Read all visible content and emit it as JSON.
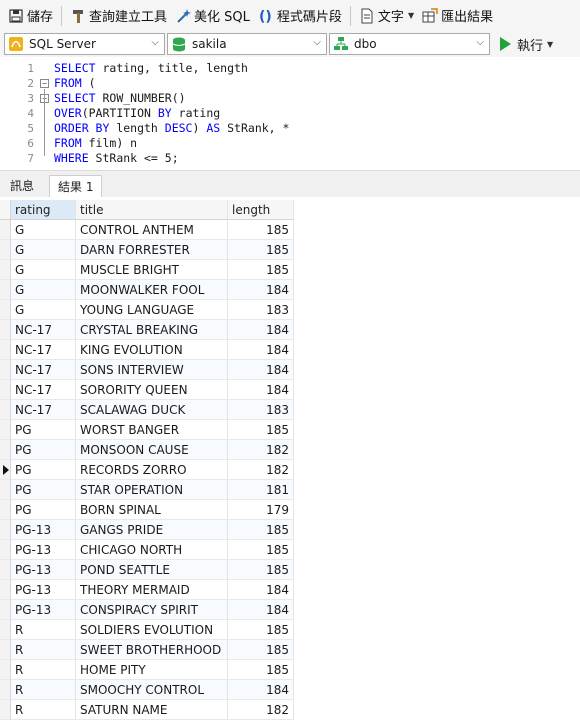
{
  "toolbar": {
    "save": "儲存",
    "query_builder": "查詢建立工具",
    "beautify": "美化 SQL",
    "snippet": "程式碼片段",
    "text": "文字",
    "export": "匯出結果"
  },
  "connection": {
    "server": "SQL Server",
    "database": "sakila",
    "schema": "dbo",
    "run": "執行"
  },
  "editor": {
    "lines": [
      {
        "num": "1",
        "parts": [
          {
            "t": "SELECT",
            "k": true
          },
          {
            "t": " rating, title, length",
            "k": false
          }
        ]
      },
      {
        "num": "2",
        "parts": [
          {
            "t": "FROM",
            "k": true
          },
          {
            "t": " (",
            "k": false
          }
        ]
      },
      {
        "num": "3",
        "parts": [
          {
            "t": "SELECT",
            "k": true
          },
          {
            "t": " ROW_NUMBER()",
            "k": false
          }
        ]
      },
      {
        "num": "4",
        "parts": [
          {
            "t": "OVER",
            "k": true
          },
          {
            "t": "(PARTITION ",
            "k": false
          },
          {
            "t": "BY",
            "k": true
          },
          {
            "t": " rating",
            "k": false
          }
        ]
      },
      {
        "num": "5",
        "parts": [
          {
            "t": "ORDER BY",
            "k": true
          },
          {
            "t": " length ",
            "k": false
          },
          {
            "t": "DESC",
            "k": true
          },
          {
            "t": ") ",
            "k": false
          },
          {
            "t": "AS",
            "k": true
          },
          {
            "t": " StRank, *",
            "k": false
          }
        ]
      },
      {
        "num": "6",
        "parts": [
          {
            "t": "FROM",
            "k": true
          },
          {
            "t": " film) n",
            "k": false
          }
        ]
      },
      {
        "num": "7",
        "parts": [
          {
            "t": "WHERE",
            "k": true
          },
          {
            "t": " StRank <= ",
            "k": false
          },
          {
            "t": "5",
            "k": false
          },
          {
            "t": ";",
            "k": false
          }
        ]
      }
    ]
  },
  "tabs": {
    "messages": "訊息",
    "result1": "結果 1"
  },
  "grid": {
    "columns": [
      "rating",
      "title",
      "length"
    ],
    "rows": [
      [
        "G",
        "CONTROL ANTHEM",
        "185"
      ],
      [
        "G",
        "DARN FORRESTER",
        "185"
      ],
      [
        "G",
        "MUSCLE BRIGHT",
        "185"
      ],
      [
        "G",
        "MOONWALKER FOOL",
        "184"
      ],
      [
        "G",
        "YOUNG LANGUAGE",
        "183"
      ],
      [
        "NC-17",
        "CRYSTAL BREAKING",
        "184"
      ],
      [
        "NC-17",
        "KING EVOLUTION",
        "184"
      ],
      [
        "NC-17",
        "SONS INTERVIEW",
        "184"
      ],
      [
        "NC-17",
        "SORORITY QUEEN",
        "184"
      ],
      [
        "NC-17",
        "SCALAWAG DUCK",
        "183"
      ],
      [
        "PG",
        "WORST BANGER",
        "185"
      ],
      [
        "PG",
        "MONSOON CAUSE",
        "182"
      ],
      [
        "PG",
        "RECORDS ZORRO",
        "182"
      ],
      [
        "PG",
        "STAR OPERATION",
        "181"
      ],
      [
        "PG",
        "BORN SPINAL",
        "179"
      ],
      [
        "PG-13",
        "GANGS PRIDE",
        "185"
      ],
      [
        "PG-13",
        "CHICAGO NORTH",
        "185"
      ],
      [
        "PG-13",
        "POND SEATTLE",
        "185"
      ],
      [
        "PG-13",
        "THEORY MERMAID",
        "184"
      ],
      [
        "PG-13",
        "CONSPIRACY SPIRIT",
        "184"
      ],
      [
        "R",
        "SOLDIERS EVOLUTION",
        "185"
      ],
      [
        "R",
        "SWEET BROTHERHOOD",
        "185"
      ],
      [
        "R",
        "HOME PITY",
        "185"
      ],
      [
        "R",
        "SMOOCHY CONTROL",
        "184"
      ],
      [
        "R",
        "SATURN NAME",
        "182"
      ]
    ],
    "current_row": 12
  }
}
